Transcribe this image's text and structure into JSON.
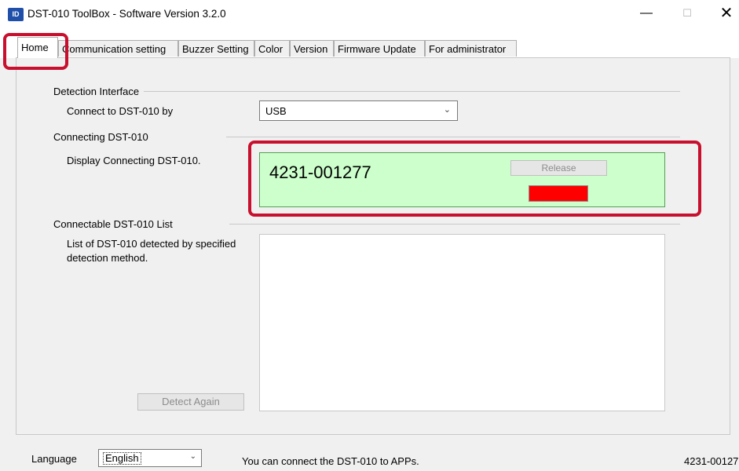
{
  "window": {
    "icon_text": "ID",
    "title": "DST-010 ToolBox - Software Version 3.2.0",
    "minimize_glyph": "—",
    "maximize_glyph": "☐",
    "close_glyph": "✕"
  },
  "tabs": [
    {
      "label": "Home"
    },
    {
      "label": "Communication setting"
    },
    {
      "label": "Buzzer Setting"
    },
    {
      "label": "Color"
    },
    {
      "label": "Version"
    },
    {
      "label": "Firmware Update"
    },
    {
      "label": "For administrator"
    }
  ],
  "detection_interface": {
    "title": "Detection Interface",
    "connect_label": "Connect to DST-010 by",
    "selected": "USB",
    "arrow": "⌄"
  },
  "connecting": {
    "title": "Connecting DST-010",
    "description": "Display Connecting DST-010.",
    "serial": "4231-001277",
    "release_label": "Release",
    "indicator_color": "#ff0000"
  },
  "connectable": {
    "title": "Connectable DST-010 List",
    "description_line1": "List of DST-010 detected by specified",
    "description_line2": "detection method.",
    "detect_again_label": "Detect Again"
  },
  "status_bar": {
    "language_label": "Language",
    "language_value": "English",
    "language_arrow": "⌄",
    "message": "You can connect the DST-010 to APPs.",
    "serial": "4231-00127"
  },
  "colors": {
    "highlight": "#c8102e",
    "connected_bg": "#ccffcc"
  }
}
